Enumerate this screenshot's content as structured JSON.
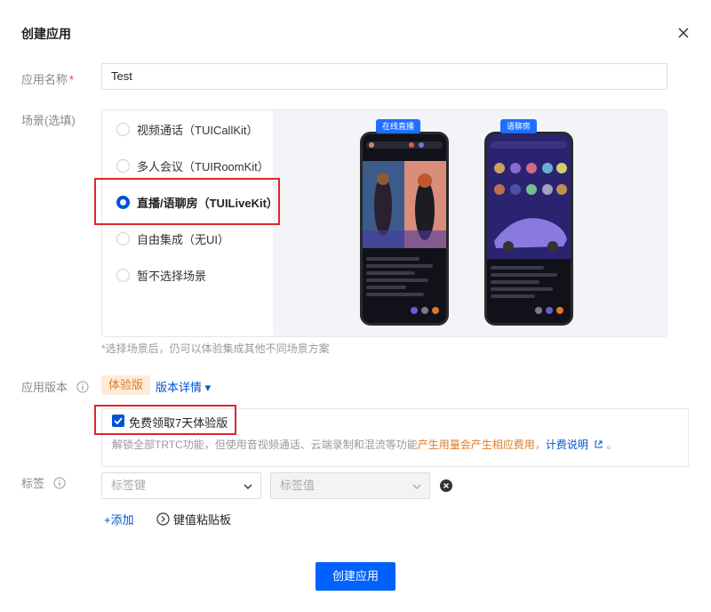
{
  "dialog": {
    "title": "创建应用",
    "submit_label": "创建应用"
  },
  "form": {
    "name_label": "应用名称",
    "required_mark": "*",
    "name_value": "Test",
    "scene_label": "场景(选填)",
    "scene_options": [
      {
        "label": "视频通话（TUICallKit）",
        "selected": false
      },
      {
        "label": "多人会议（TUIRoomKit）",
        "selected": false
      },
      {
        "label": "直播/语聊房（TUILiveKit）",
        "selected": true
      },
      {
        "label": "自由集成（无UI）",
        "selected": false
      },
      {
        "label": "暂不选择场景",
        "selected": false
      }
    ],
    "preview_tags": [
      "在线直播",
      "语聊房"
    ],
    "scene_hint": "*选择场景后，仍可以体验集成其他不同场景方案",
    "version_label": "应用版本",
    "version_badge": "体验版",
    "version_detail_link": "版本详情 ▾",
    "trial_checkbox_label": "免费领取7天体验版",
    "trial_checked": true,
    "trial_desc_prefix": "解锁全部TRTC功能，但使用音视频通话、云端录制和混流等功能",
    "trial_desc_warn": "产生用量会产生相应费用",
    "trial_desc_sep": "，",
    "trial_desc_link": "计费说明",
    "trial_desc_suffix": "。",
    "tags_label": "标签",
    "tag_key_placeholder": "标签键",
    "tag_value_placeholder": "标签值",
    "add_label": "添加",
    "paste_label": "键值粘贴板"
  },
  "colors": {
    "primary": "#0052d9",
    "button": "#0061ff",
    "warning": "#e07b1e",
    "highlight_box": "#e0252b"
  }
}
